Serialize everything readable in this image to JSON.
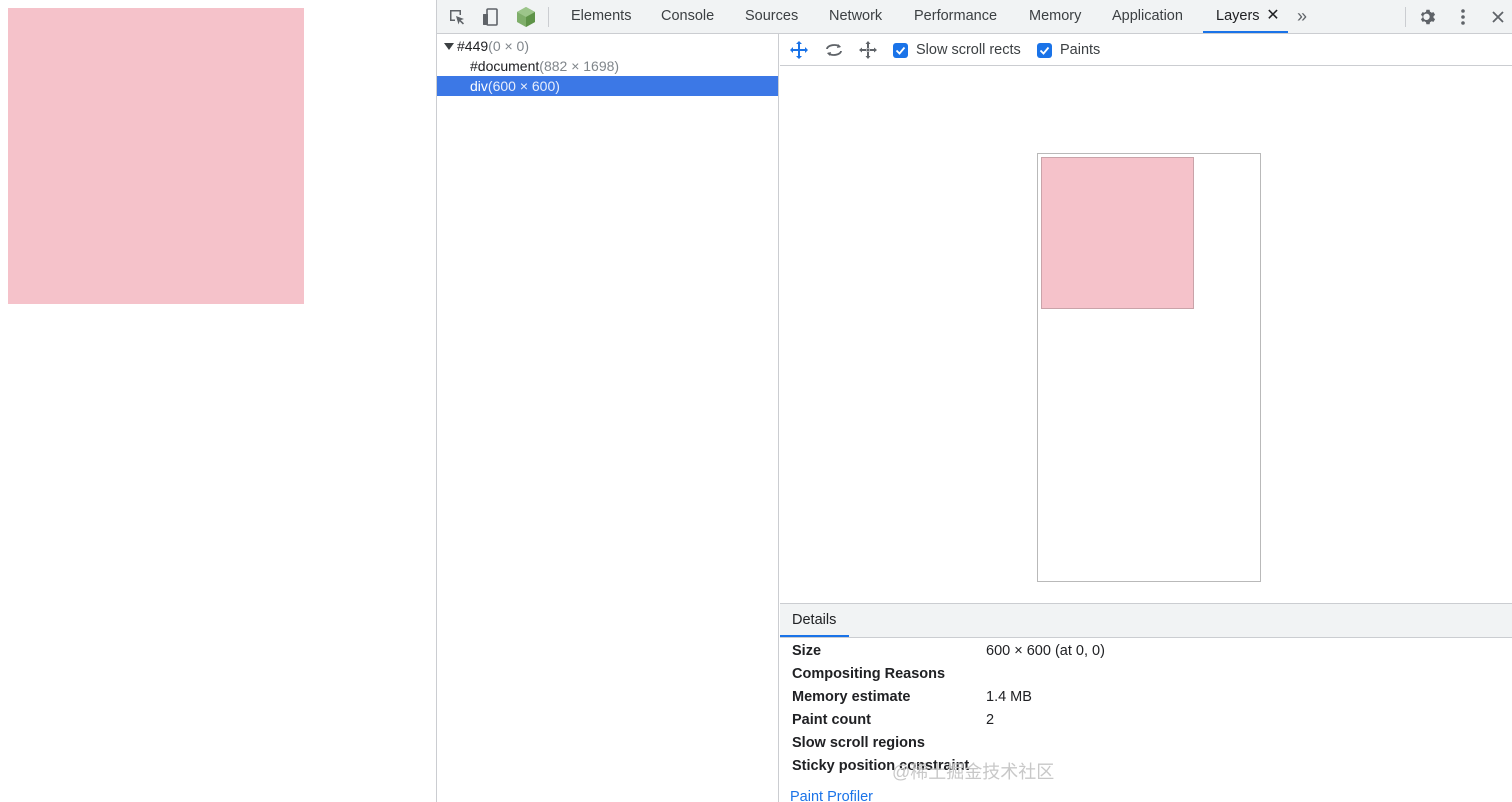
{
  "page": {
    "box_color": "#f5c2ca"
  },
  "devtools": {
    "tabs": [
      {
        "label": "Elements"
      },
      {
        "label": "Console"
      },
      {
        "label": "Sources"
      },
      {
        "label": "Network"
      },
      {
        "label": "Performance"
      },
      {
        "label": "Memory"
      },
      {
        "label": "Application"
      },
      {
        "label": "Layers",
        "active": true
      }
    ],
    "close_glyph": "✕",
    "more_glyph": "»",
    "icons": {
      "inspect": "inspect-element-icon",
      "device": "device-toolbar-icon",
      "node": "node-cube-icon",
      "settings": "gear-icon",
      "menu": "more-vert-icon"
    },
    "accent": "#1a73e8"
  },
  "layer_tree": {
    "rows": [
      {
        "name": "#449",
        "size": "(0 × 0)"
      },
      {
        "name": "#document",
        "size": "(882 × 1698)"
      },
      {
        "name": "div",
        "size": "(600 × 600)",
        "selected": true
      }
    ]
  },
  "layers_view": {
    "toolbar": {
      "icons": [
        "pan-mode-icon",
        "rotate-mode-icon",
        "reset-transform-icon"
      ],
      "slow_scroll_rects": {
        "label": "Slow scroll rects",
        "checked": true
      },
      "paints": {
        "label": "Paints",
        "checked": true
      }
    }
  },
  "details": {
    "tab": "Details",
    "rows": [
      {
        "key": "Size",
        "value": "600 × 600 (at 0, 0)"
      },
      {
        "key": "Compositing Reasons",
        "value": ""
      },
      {
        "key": "Memory estimate",
        "value": "1.4 MB"
      },
      {
        "key": "Paint count",
        "value": "2"
      },
      {
        "key": "Slow scroll regions",
        "value": ""
      },
      {
        "key": "Sticky position constraint",
        "value": ""
      }
    ],
    "paint_profiler": "Paint Profiler"
  },
  "watermark": "@稀土掘金技术社区"
}
